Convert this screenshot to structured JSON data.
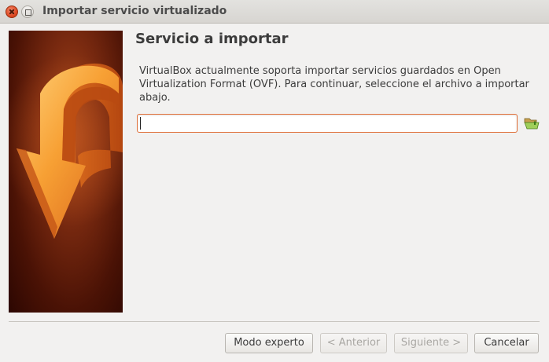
{
  "window": {
    "title": "Importar servicio virtualizado"
  },
  "page": {
    "heading": "Servicio a importar",
    "description": "VirtualBox actualmente soporta importar servicios guardados en Open Virtualization Format (OVF). Para continuar, seleccione el archivo a importar abajo."
  },
  "file_field": {
    "value": "",
    "folder_icon": "folder-open-icon"
  },
  "buttons": {
    "expert": "Modo experto",
    "back": "< Anterior",
    "next": "Siguiente >",
    "cancel": "Cancelar"
  },
  "colors": {
    "input_focus_border": "#e0703a",
    "banner_dark": "#4a1205",
    "arrow_orange": "#f39a30"
  }
}
